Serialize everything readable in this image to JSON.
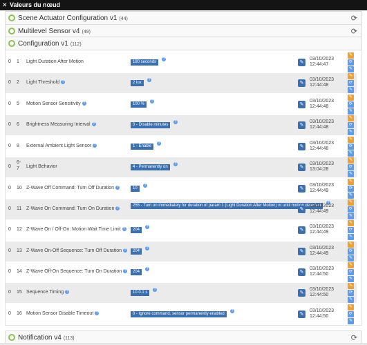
{
  "window": {
    "title": "Valeurs du nœud",
    "close_icon": "close-icon"
  },
  "sections": [
    {
      "name": "Scene Actuator Configuration v1",
      "count": "(44)"
    },
    {
      "name": "Multilevel Sensor v4",
      "count": "(49)"
    },
    {
      "name": "Configuration v1",
      "count": "(112)"
    },
    {
      "name": "Notification v4",
      "count": "(113)"
    }
  ],
  "rows": [
    {
      "i0": "0",
      "n": "1",
      "label": "Light Duration After Motion",
      "has_q": false,
      "value": "180 seconds",
      "date": "03/10/2023",
      "time": "12:44:47"
    },
    {
      "i0": "0",
      "n": "2",
      "label": "Light Threshold",
      "has_q": true,
      "value": "2 lux",
      "date": "03/10/2023",
      "time": "12:44:48"
    },
    {
      "i0": "0",
      "n": "5",
      "label": "Motion Sensor Sensitivity",
      "has_q": true,
      "value": "100 %",
      "date": "03/10/2023",
      "time": "12:44:48"
    },
    {
      "i0": "0",
      "n": "6",
      "label": "Brightness Measuring Interval",
      "has_q": true,
      "value": "0 - Disable minutes",
      "date": "03/10/2023",
      "time": "12:44:48"
    },
    {
      "i0": "0",
      "n": "8",
      "label": "External Ambient Light Sensor",
      "has_q": true,
      "value": "1 - Enable",
      "date": "03/10/2023",
      "time": "12:44:48"
    },
    {
      "i0": "0",
      "n": "6-7",
      "label": "Light Behavior",
      "has_q": false,
      "value": "4 - Permanently on",
      "date": "03/10/2023",
      "time": "13:04:28"
    },
    {
      "i0": "0",
      "n": "10",
      "label": "Z-Wave Off Command: Turn Off Duration",
      "has_q": true,
      "value": "10",
      "date": "03/10/2023",
      "time": "12:44:49"
    },
    {
      "i0": "0",
      "n": "11",
      "label": "Z-Wave On Command: Turn On Duration",
      "has_q": true,
      "value": "255 - Turn on immediately for duration of param 1 (Light Duration After Motion) or until motion detected",
      "date": "03/10/2023",
      "time": "12:44:49"
    },
    {
      "i0": "0",
      "n": "12",
      "label": "Z-Wave On / Off-On: Motion Wait Time Limit",
      "has_q": true,
      "value": "204",
      "date": "03/10/2023",
      "time": "12:44:49"
    },
    {
      "i0": "0",
      "n": "13",
      "label": "Z-Wave On-Off Sequence: Turn Off Duration",
      "has_q": true,
      "value": "204",
      "date": "03/10/2023",
      "time": "12:44:49"
    },
    {
      "i0": "0",
      "n": "14",
      "label": "Z-Wave Off-On Sequence: Turn On Duration",
      "has_q": true,
      "value": "204",
      "date": "03/10/2023",
      "time": "12:44:50"
    },
    {
      "i0": "0",
      "n": "15",
      "label": "Sequence Timing",
      "has_q": true,
      "value": "10 0.1 s",
      "date": "03/10/2023",
      "time": "12:44:50"
    },
    {
      "i0": "0",
      "n": "16",
      "label": "Motion Sensor Disable Timeout",
      "has_q": true,
      "value": "0 - Ignore command, sensor permanently enabled",
      "date": "03/10/2023",
      "time": "12:44:50"
    }
  ],
  "colors": {
    "accent": "#3a6fb0",
    "orange": "#f0a030",
    "green": "#8cc152"
  }
}
